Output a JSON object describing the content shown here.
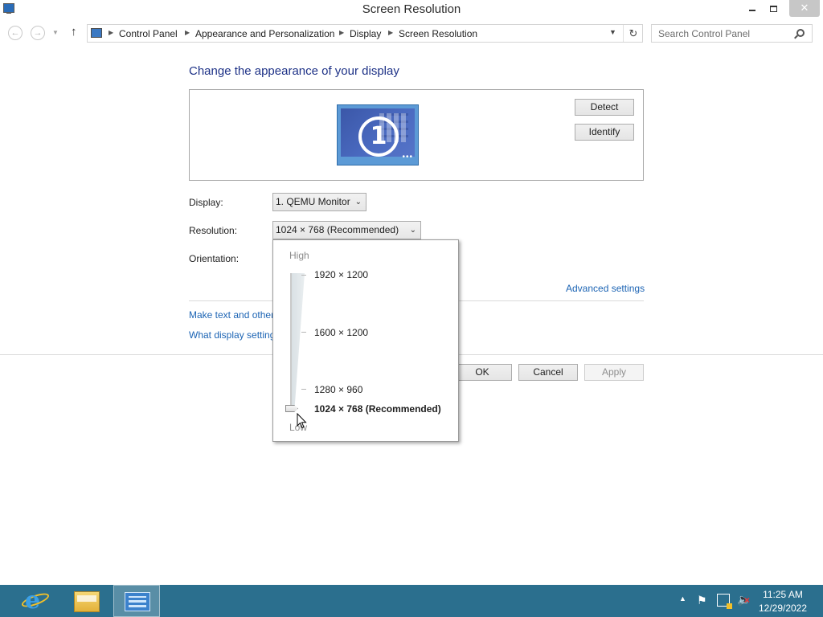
{
  "window": {
    "title": "Screen Resolution",
    "controls": {
      "minimize": "",
      "maximize": "",
      "close": "✕"
    }
  },
  "navbar": {
    "back_icon": "back-arrow-icon",
    "forward_icon": "forward-arrow-icon",
    "up_icon": "up-arrow-icon",
    "breadcrumbs": [
      "Control Panel",
      "Appearance and Personalization",
      "Display",
      "Screen Resolution"
    ],
    "search_placeholder": "Search Control Panel"
  },
  "main": {
    "heading": "Change the appearance of your display",
    "monitor_number": "1",
    "detect_label": "Detect",
    "identify_label": "Identify",
    "display_label": "Display:",
    "display_value": "1. QEMU Monitor",
    "resolution_label": "Resolution:",
    "resolution_value": "1024 × 768 (Recommended)",
    "orientation_label": "Orientation:",
    "advanced_link": "Advanced settings",
    "link_text_size": "Make text and other",
    "link_display_settings": "What display setting",
    "ok_label": "OK",
    "cancel_label": "Cancel",
    "apply_label": "Apply"
  },
  "resolution_popup": {
    "high_label": "High",
    "low_label": "Low",
    "options": [
      {
        "label": "1920 × 1200",
        "selected": false
      },
      {
        "label": "1600 × 1200",
        "selected": false
      },
      {
        "label": "1280 × 960",
        "selected": false
      },
      {
        "label": "1024 × 768 (Recommended)",
        "selected": true
      }
    ]
  },
  "taskbar": {
    "pinned": [
      "internet-explorer-icon",
      "file-explorer-icon",
      "control-panel-icon"
    ],
    "clock": {
      "time": "11:25 AM",
      "date": "12/29/2022"
    }
  }
}
